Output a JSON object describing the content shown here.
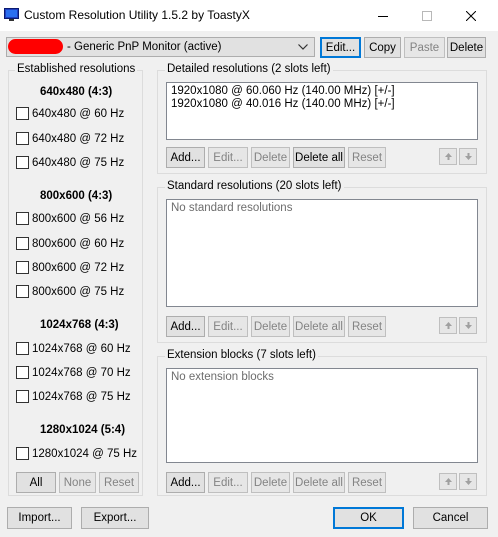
{
  "window": {
    "title": "Custom Resolution Utility 1.5.2 by ToastyX",
    "controls": {
      "minimize": "–",
      "maximize": "☐",
      "close": "✕"
    }
  },
  "monitor": {
    "selected": "- Generic PnP Monitor (active)",
    "buttons": {
      "edit": "Edit...",
      "copy": "Copy",
      "paste": "Paste",
      "delete": "Delete"
    }
  },
  "established": {
    "label": "Established resolutions",
    "groups": [
      {
        "heading": "640x480 (4:3)",
        "items": [
          "640x480 @ 60 Hz",
          "640x480 @ 72 Hz",
          "640x480 @ 75 Hz"
        ]
      },
      {
        "heading": "800x600 (4:3)",
        "items": [
          "800x600 @ 56 Hz",
          "800x600 @ 60 Hz",
          "800x600 @ 72 Hz",
          "800x600 @ 75 Hz"
        ]
      },
      {
        "heading": "1024x768 (4:3)",
        "items": [
          "1024x768 @ 60 Hz",
          "1024x768 @ 70 Hz",
          "1024x768 @ 75 Hz"
        ]
      },
      {
        "heading": "1280x1024 (5:4)",
        "items": [
          "1280x1024 @ 75 Hz"
        ]
      }
    ],
    "buttons": {
      "all": "All",
      "none": "None",
      "reset": "Reset"
    }
  },
  "detailed": {
    "label": "Detailed resolutions (2 slots left)",
    "items": [
      "1920x1080 @ 60.060 Hz (140.00 MHz) [+/-]",
      "1920x1080 @ 40.016 Hz (140.00 MHz) [+/-]"
    ],
    "buttons": {
      "add": "Add...",
      "edit": "Edit...",
      "delete": "Delete",
      "delete_all": "Delete all",
      "reset": "Reset"
    }
  },
  "standard": {
    "label": "Standard resolutions (20 slots left)",
    "placeholder": "No standard resolutions",
    "buttons": {
      "add": "Add...",
      "edit": "Edit...",
      "delete": "Delete",
      "delete_all": "Delete all",
      "reset": "Reset"
    }
  },
  "extension": {
    "label": "Extension blocks (7 slots left)",
    "placeholder": "No extension blocks",
    "buttons": {
      "add": "Add...",
      "edit": "Edit...",
      "delete": "Delete",
      "delete_all": "Delete all",
      "reset": "Reset"
    }
  },
  "footer": {
    "import": "Import...",
    "export": "Export...",
    "ok": "OK",
    "cancel": "Cancel"
  },
  "colors": {
    "accent": "#0078d7",
    "redaction": "#ff0000"
  }
}
